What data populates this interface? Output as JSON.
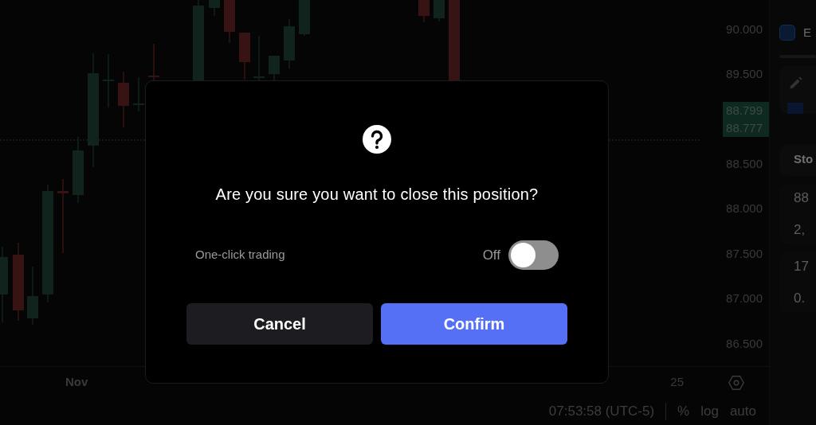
{
  "chart": {
    "price_axis": {
      "labels_above": [
        "90.000",
        "89.500"
      ],
      "current_prices": [
        "88.799",
        "88.777"
      ],
      "labels_below": [
        "88.500",
        "88.000",
        "87.500",
        "87.000",
        "86.500"
      ]
    },
    "time_axis": {
      "labels": [
        "Nov",
        "25"
      ]
    }
  },
  "status_bar": {
    "time": "07:53:58 (UTC-5)",
    "buttons": [
      "%",
      "log",
      "auto"
    ]
  },
  "sidebar": {
    "texts": [
      "E"
    ],
    "card_label": "Sto",
    "card_values": [
      [
        "88",
        "2,"
      ],
      [
        "17",
        "0."
      ]
    ]
  },
  "dialog": {
    "message": "Are you sure you want to close this position?",
    "setting": {
      "label": "One-click trading",
      "state_label": "Off",
      "on": false
    },
    "buttons": [
      {
        "label": "Cancel",
        "kind": "secondary"
      },
      {
        "label": "Confirm",
        "kind": "primary"
      }
    ]
  }
}
